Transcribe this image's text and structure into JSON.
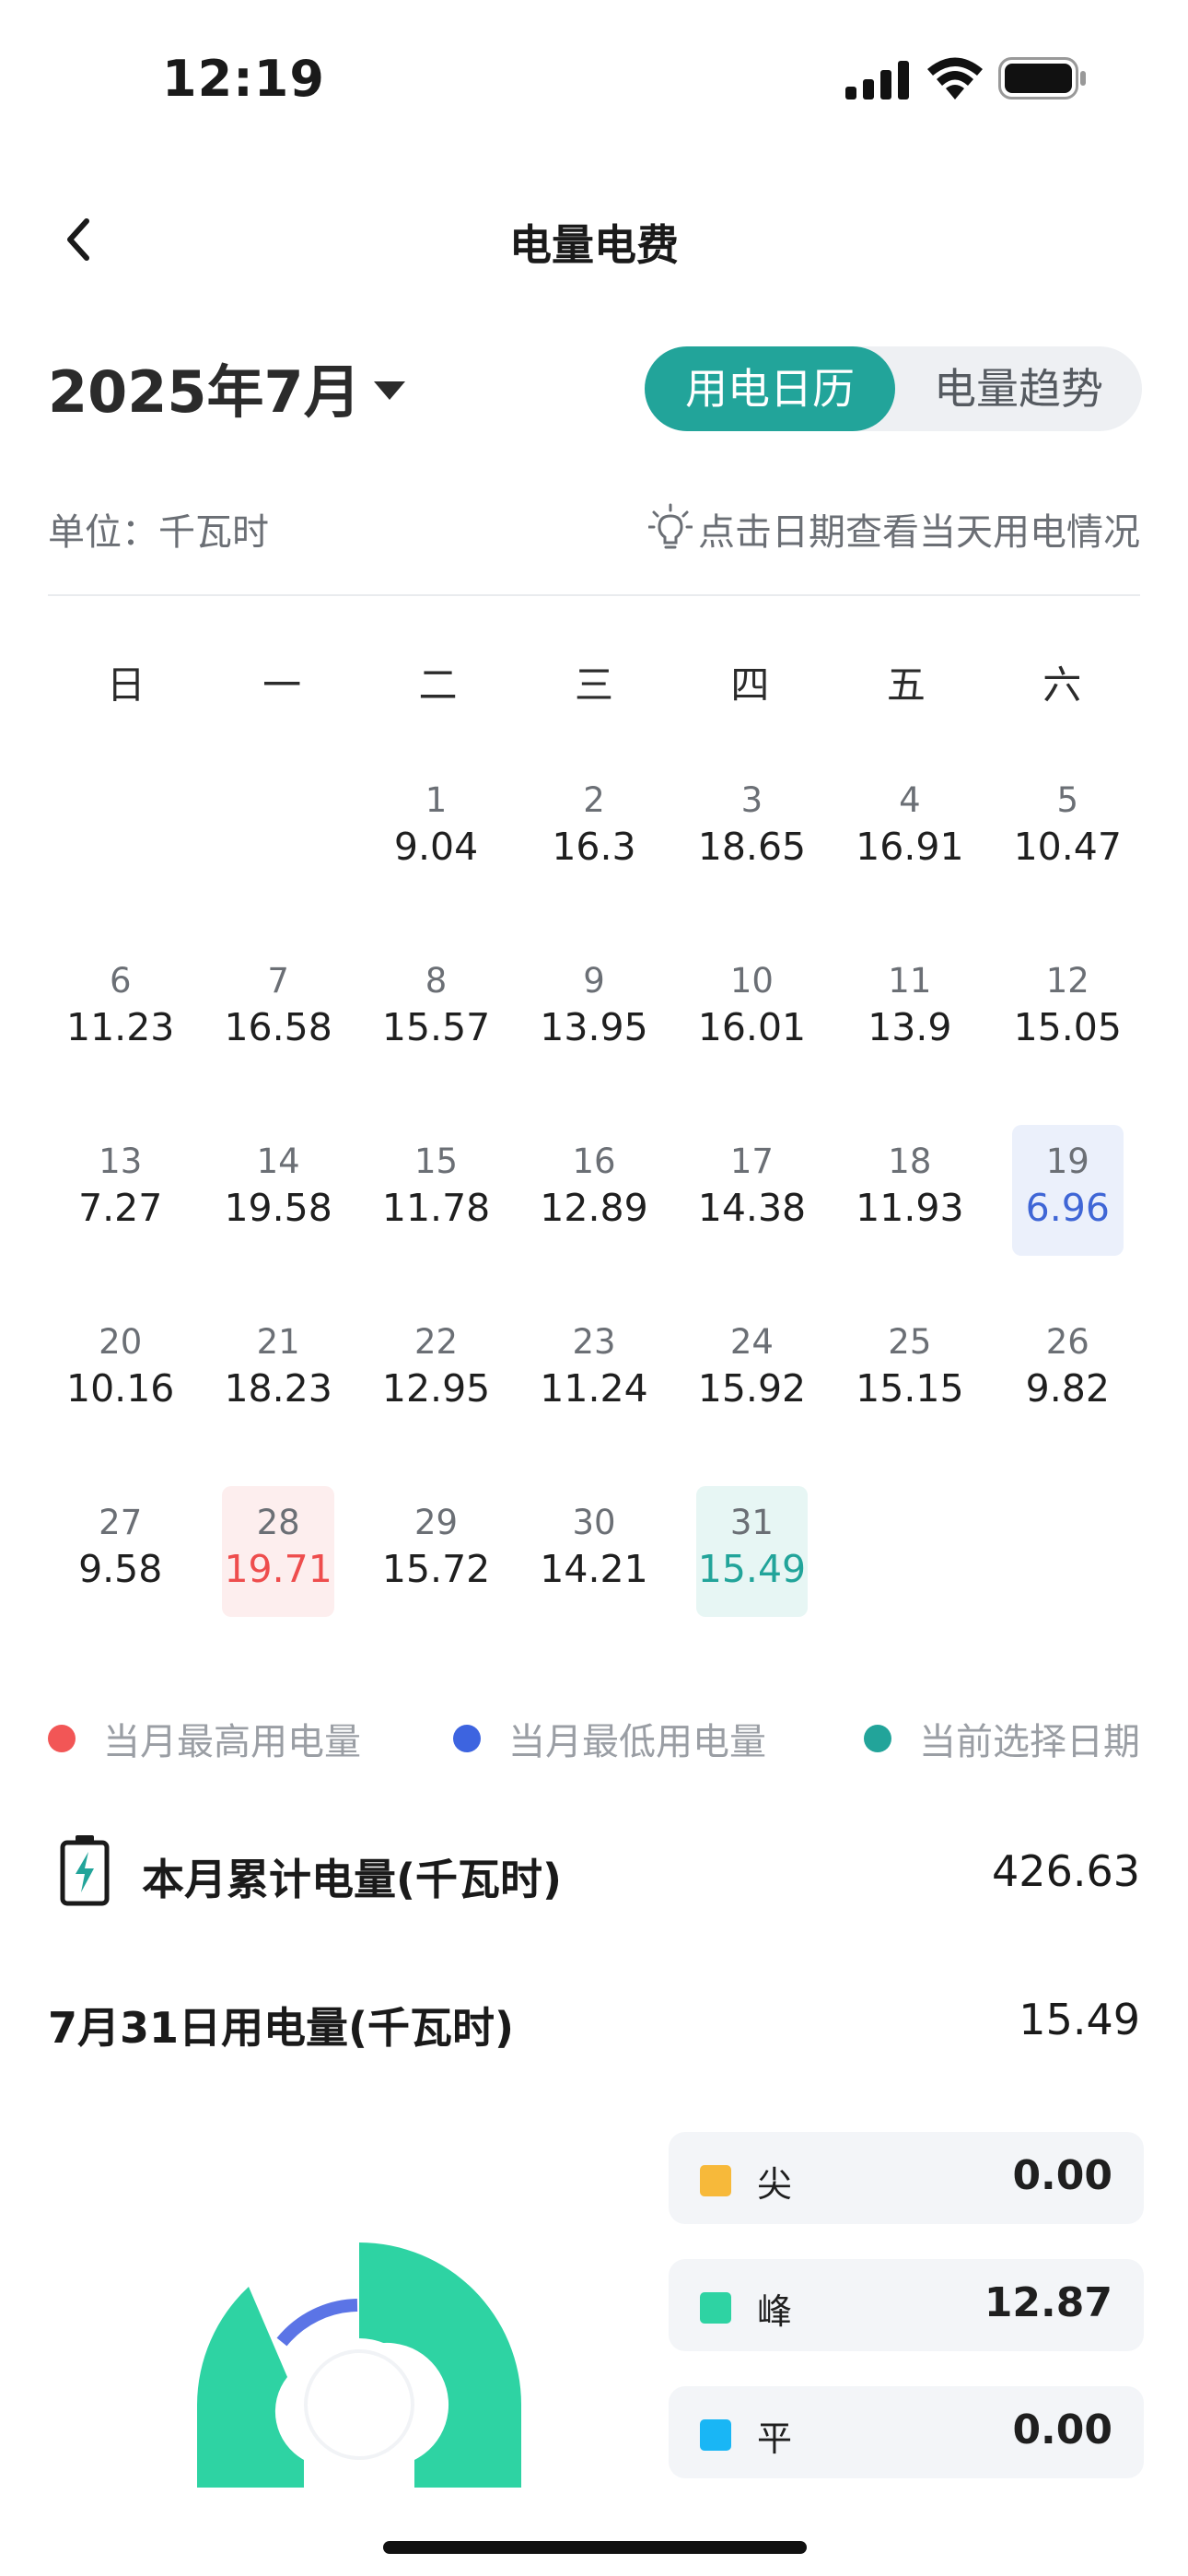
{
  "status_bar": {
    "time": "12:19"
  },
  "nav": {
    "title": "电量电费"
  },
  "month_selector": {
    "label": "2025年7月"
  },
  "view_toggle": {
    "active": "用电日历",
    "inactive": "电量趋势"
  },
  "unit_label": "单位：千瓦时",
  "hint_text": "点击日期查看当天用电情况",
  "weekdays": [
    "日",
    "一",
    "二",
    "三",
    "四",
    "五",
    "六"
  ],
  "calendar": {
    "leading_blanks": 2,
    "days": [
      {
        "day": "1",
        "value": "9.04"
      },
      {
        "day": "2",
        "value": "16.3"
      },
      {
        "day": "3",
        "value": "18.65"
      },
      {
        "day": "4",
        "value": "16.91"
      },
      {
        "day": "5",
        "value": "10.47"
      },
      {
        "day": "6",
        "value": "11.23"
      },
      {
        "day": "7",
        "value": "16.58"
      },
      {
        "day": "8",
        "value": "15.57"
      },
      {
        "day": "9",
        "value": "13.95"
      },
      {
        "day": "10",
        "value": "16.01"
      },
      {
        "day": "11",
        "value": "13.9"
      },
      {
        "day": "12",
        "value": "15.05"
      },
      {
        "day": "13",
        "value": "7.27"
      },
      {
        "day": "14",
        "value": "19.58"
      },
      {
        "day": "15",
        "value": "11.78"
      },
      {
        "day": "16",
        "value": "12.89"
      },
      {
        "day": "17",
        "value": "14.38"
      },
      {
        "day": "18",
        "value": "11.93"
      },
      {
        "day": "19",
        "value": "6.96",
        "state": "low"
      },
      {
        "day": "20",
        "value": "10.16"
      },
      {
        "day": "21",
        "value": "18.23"
      },
      {
        "day": "22",
        "value": "12.95"
      },
      {
        "day": "23",
        "value": "11.24"
      },
      {
        "day": "24",
        "value": "15.92"
      },
      {
        "day": "25",
        "value": "15.15"
      },
      {
        "day": "26",
        "value": "9.82"
      },
      {
        "day": "27",
        "value": "9.58"
      },
      {
        "day": "28",
        "value": "19.71",
        "state": "high"
      },
      {
        "day": "29",
        "value": "15.72"
      },
      {
        "day": "30",
        "value": "14.21"
      },
      {
        "day": "31",
        "value": "15.49",
        "state": "sel"
      }
    ]
  },
  "legend": {
    "high": {
      "label": "当月最高用电量",
      "color": "#f25656"
    },
    "low": {
      "label": "当月最低用电量",
      "color": "#3d64e0"
    },
    "selected": {
      "label": "当前选择日期",
      "color": "#22a49a"
    }
  },
  "month_total": {
    "label": "本月累计电量(千瓦时)",
    "value": "426.63"
  },
  "day_total": {
    "label": "7月31日用电量(千瓦时)",
    "value": "15.49"
  },
  "tariffs": [
    {
      "name": "尖",
      "value": "0.00",
      "color": "#f7b93a"
    },
    {
      "name": "峰",
      "value": "12.87",
      "color": "#2ed3a3"
    },
    {
      "name": "平",
      "value": "0.00",
      "color": "#19b6f5"
    }
  ],
  "icons": [
    "back-chevron-icon",
    "lightbulb-icon",
    "battery-charging-icon",
    "signal-icon",
    "wifi-icon",
    "battery-icon"
  ]
}
